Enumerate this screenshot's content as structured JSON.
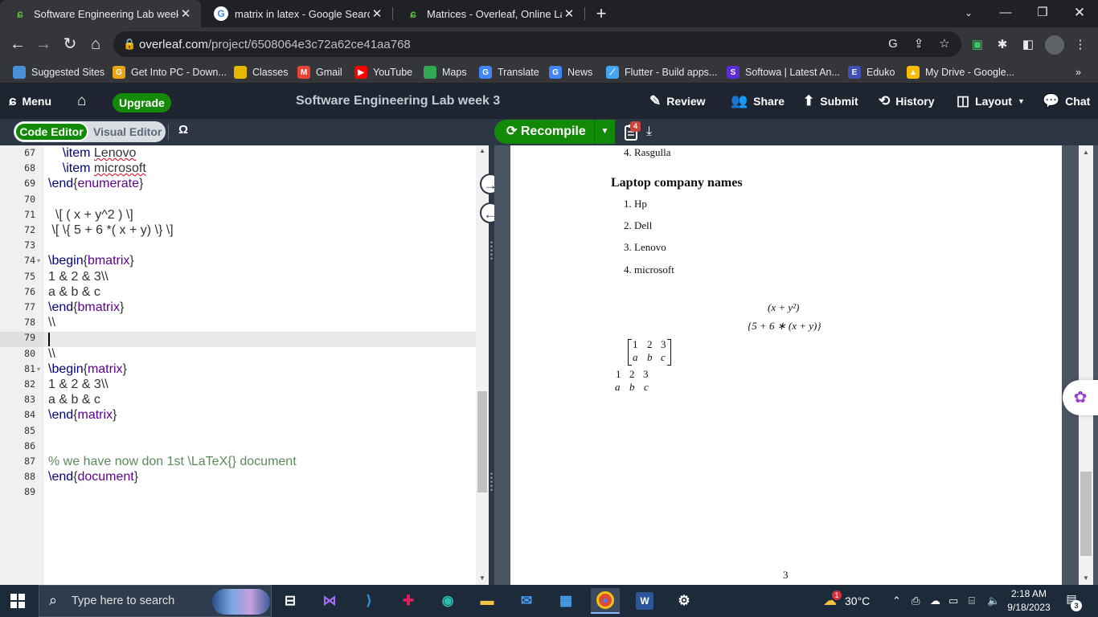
{
  "browser": {
    "tabs": [
      {
        "title": "Software Engineering Lab week 3",
        "favicon": "overleaf-icon",
        "active": true
      },
      {
        "title": "matrix in latex - Google Search",
        "favicon": "google-icon",
        "active": false
      },
      {
        "title": "Matrices - Overleaf, Online LaTeX",
        "favicon": "overleaf-icon",
        "active": false
      }
    ],
    "url_host": "overleaf.com",
    "url_path": "/project/6508064e3c72a62ce41aa768",
    "bookmarks": [
      {
        "label": "Suggested Sites",
        "icon": "suggested-sites-icon",
        "color": "#4a90d9"
      },
      {
        "label": "Get Into PC - Down...",
        "icon": "g-icon",
        "color": "#e8a317"
      },
      {
        "label": "Classes",
        "icon": "classes-icon",
        "color": "#e6b800"
      },
      {
        "label": "Gmail",
        "icon": "gmail-icon",
        "color": "#ea4335"
      },
      {
        "label": "YouTube",
        "icon": "youtube-icon",
        "color": "#ff0000"
      },
      {
        "label": "Maps",
        "icon": "maps-icon",
        "color": "#34a853"
      },
      {
        "label": "Translate",
        "icon": "translate-icon",
        "color": "#4285f4"
      },
      {
        "label": "News",
        "icon": "news-icon",
        "color": "#4285f4"
      },
      {
        "label": "Flutter - Build apps...",
        "icon": "flutter-icon",
        "color": "#42a5f5"
      },
      {
        "label": "Softowa | Latest An...",
        "icon": "softowa-icon",
        "color": "#5b2bd6"
      },
      {
        "label": "Eduko",
        "icon": "eduko-icon",
        "color": "#3f51b5"
      },
      {
        "label": "My Drive - Google...",
        "icon": "drive-icon",
        "color": "#fbbc04"
      }
    ]
  },
  "overleaf": {
    "menu_label": "Menu",
    "upgrade_label": "Upgrade",
    "project_title": "Software Engineering Lab week 3",
    "review_label": "Review",
    "share_label": "Share",
    "submit_label": "Submit",
    "history_label": "History",
    "layout_label": "Layout",
    "chat_label": "Chat",
    "code_editor_label": "Code Editor",
    "visual_editor_label": "Visual Editor",
    "omega_label": "Ω",
    "recompile_label": "Recompile",
    "logs_count": "4"
  },
  "editor": {
    "lines": [
      {
        "n": "67",
        "text": "    \\item Lenovo"
      },
      {
        "n": "68",
        "text": "    \\item microsoft"
      },
      {
        "n": "69",
        "text": "\\end{enumerate}"
      },
      {
        "n": "70",
        "text": ""
      },
      {
        "n": "71",
        "text": "  \\[ ( x + y^2 ) \\]"
      },
      {
        "n": "72",
        "text": " \\[ \\{ 5 + 6 *( x + y) \\} \\]"
      },
      {
        "n": "73",
        "text": ""
      },
      {
        "n": "74",
        "text": "\\begin{bmatrix}"
      },
      {
        "n": "75",
        "text": "1 & 2 & 3\\\\"
      },
      {
        "n": "76",
        "text": "a & b & c"
      },
      {
        "n": "77",
        "text": "\\end{bmatrix}"
      },
      {
        "n": "78",
        "text": "\\\\"
      },
      {
        "n": "79",
        "text": ""
      },
      {
        "n": "80",
        "text": "\\\\"
      },
      {
        "n": "81",
        "text": "\\begin{matrix}"
      },
      {
        "n": "82",
        "text": "1 & 2 & 3\\\\"
      },
      {
        "n": "83",
        "text": "a & b & c"
      },
      {
        "n": "84",
        "text": "\\end{matrix}"
      },
      {
        "n": "85",
        "text": ""
      },
      {
        "n": "86",
        "text": ""
      },
      {
        "n": "87",
        "text": "% we have now don 1st \\LaTeX{} document"
      },
      {
        "n": "88",
        "text": "\\end{document}"
      },
      {
        "n": "89",
        "text": ""
      }
    ]
  },
  "preview": {
    "list1_item4": "4.  Rasgulla",
    "section_title": "Laptop company names",
    "list2": [
      "1.  Hp",
      "2.  Dell",
      "3.  Lenovo",
      "4.  microsoft"
    ],
    "eq1": "(x + y²)",
    "eq2": "{5 + 6 ∗ (x + y)}",
    "bmatrix_row1": [
      "1",
      "2",
      "3"
    ],
    "bmatrix_row2": [
      "a",
      "b",
      "c"
    ],
    "matrix_row1": [
      "1",
      "2",
      "3"
    ],
    "matrix_row2": [
      "a",
      "b",
      "c"
    ],
    "page_number": "3"
  },
  "taskbar": {
    "search_placeholder": "Type here to search",
    "weather": "30°C",
    "weather_badge": "1",
    "time": "2:18 AM",
    "date": "9/18/2023",
    "notifications": "3"
  }
}
